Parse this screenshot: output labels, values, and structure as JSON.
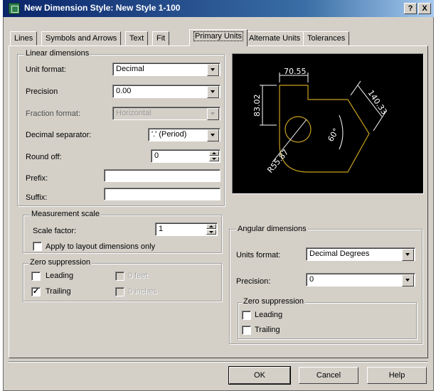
{
  "window": {
    "title": "New Dimension Style: New Style 1-100",
    "help_btn": "?",
    "close_btn": "X"
  },
  "tabs": [
    {
      "label": "Lines"
    },
    {
      "label": "Symbols and Arrows"
    },
    {
      "label": "Text"
    },
    {
      "label": "Fit"
    },
    {
      "label": "Primary Units"
    },
    {
      "label": "Alternate Units"
    },
    {
      "label": "Tolerances"
    }
  ],
  "linear": {
    "legend": "Linear dimensions",
    "unit_format": {
      "label": "Unit format:",
      "value": "Decimal"
    },
    "precision": {
      "label": "Precision",
      "value": "0.00"
    },
    "fraction_format": {
      "label": "Fraction format:",
      "value": "Horizontal"
    },
    "decimal_separator": {
      "label": "Decimal separator:",
      "value": "'.' (Period)"
    },
    "round_off": {
      "label": "Round off:",
      "value": "0"
    },
    "prefix": {
      "label": "Prefix:",
      "value": ""
    },
    "suffix": {
      "label": "Suffix:",
      "value": ""
    }
  },
  "measurement_scale": {
    "legend": "Measurement scale",
    "scale_factor": {
      "label": "Scale factor:",
      "value": "1"
    },
    "apply_layout": {
      "label": "Apply to layout dimensions only",
      "checked": false
    }
  },
  "zero_suppression_linear": {
    "legend": "Zero suppression",
    "leading": {
      "label": "Leading",
      "checked": false
    },
    "trailing": {
      "label": "Trailing",
      "checked": true
    },
    "feet": {
      "label": "0 feet"
    },
    "inches": {
      "label": "0 inches"
    }
  },
  "preview": {
    "dim_top": "70.55",
    "dim_left": "83.02",
    "dim_right": "140.33",
    "dim_angle": "60°",
    "dim_radius": "R55.87",
    "line_color": "#c8a020",
    "text_color": "#ffffff"
  },
  "angular": {
    "legend": "Angular dimensions",
    "units_format": {
      "label": "Units format:",
      "value": "Decimal Degrees"
    },
    "precision": {
      "label": "Precision:",
      "value": "0"
    },
    "zero_suppression": {
      "legend": "Zero suppression",
      "leading": {
        "label": "Leading",
        "checked": false
      },
      "trailing": {
        "label": "Trailing",
        "checked": false
      }
    }
  },
  "buttons": {
    "ok": "OK",
    "cancel": "Cancel",
    "help": "Help"
  }
}
